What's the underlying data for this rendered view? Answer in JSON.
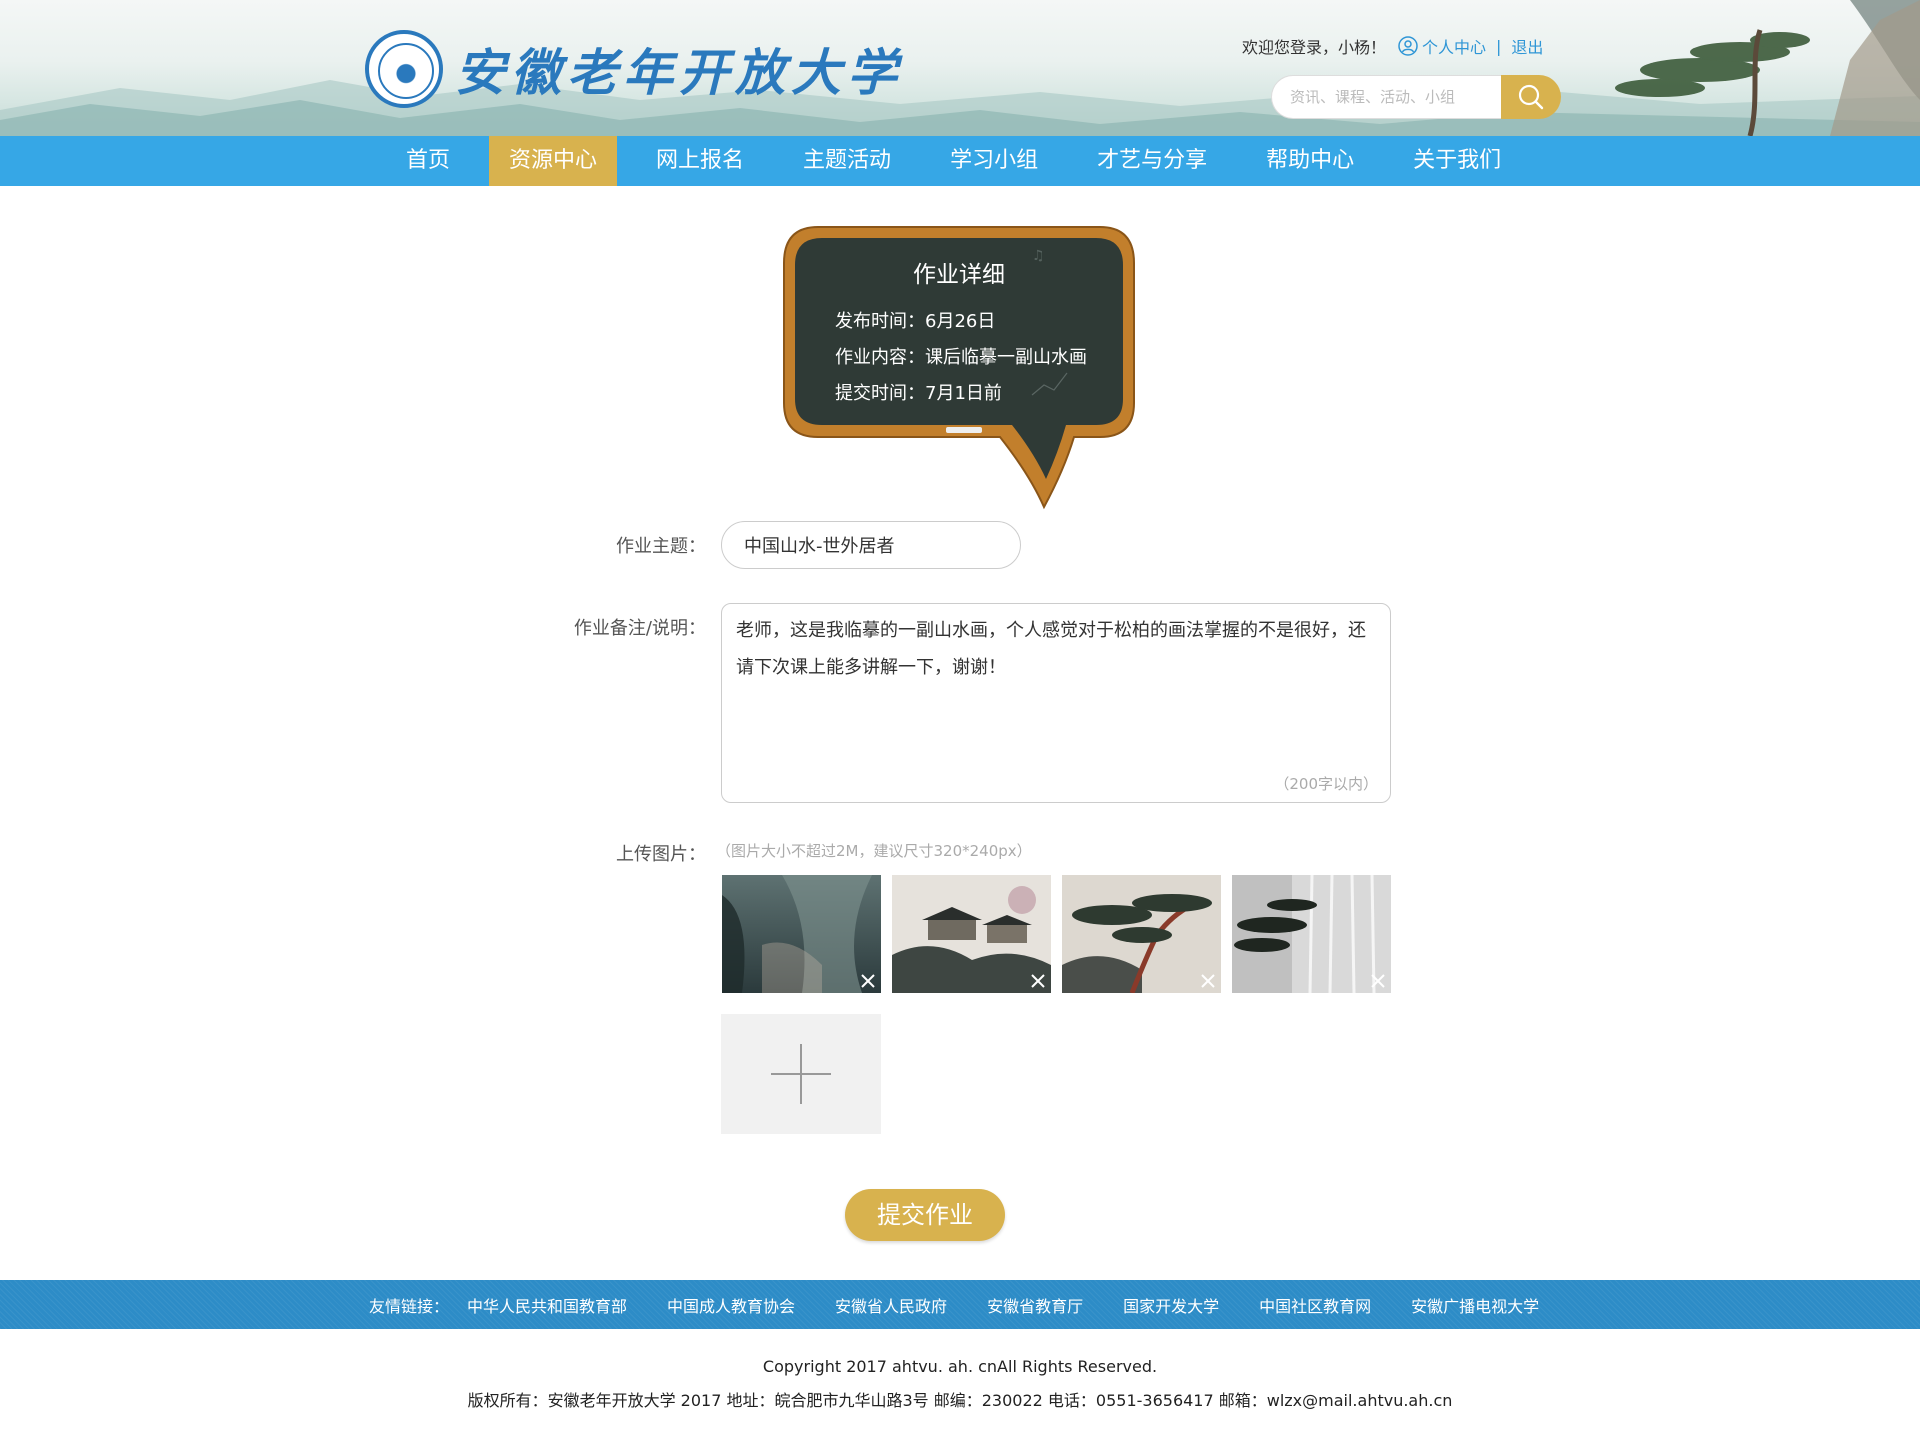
{
  "header": {
    "site_title": "安徽老年开放大学",
    "welcome": "欢迎您登录，小杨！",
    "user_center": "个人中心",
    "separator": "|",
    "logout": "退出",
    "search_placeholder": "资讯、课程、活动、小组",
    "search_icon": "search-icon",
    "logo_icon": "university-seal-icon"
  },
  "nav": {
    "items": [
      "首页",
      "资源中心",
      "网上报名",
      "主题活动",
      "学习小组",
      "才艺与分享",
      "帮助中心",
      "关于我们"
    ],
    "active": "资源中心"
  },
  "board": {
    "title": "作业详细",
    "publish": "发布时间：6月26日",
    "content": "作业内容：课后临摹一副山水画",
    "deadline": "提交时间：7月1日前"
  },
  "form": {
    "topic_label": "作业主题：",
    "topic_value": "中国山水-世外居者",
    "note_label": "作业备注/说明：",
    "note_value": "老师，这是我临摹的一副山水画，个人感觉对于松柏的画法掌握的不是很好，还请下次课上能多讲解一下，谢谢！",
    "note_limit": "（200字以内）",
    "upload_label": "上传图片：",
    "upload_hint": "（图片大小不超过2M，建议尺寸320*240px）",
    "thumbnails": [
      "landscape-painting-1",
      "landscape-painting-2",
      "landscape-painting-3",
      "landscape-painting-4"
    ],
    "remove_icon": "close-icon",
    "add_icon": "plus-icon",
    "submit": "提交作业"
  },
  "footer": {
    "links_label": "友情链接：",
    "links": [
      "中华人民共和国教育部",
      "中国成人教育协会",
      "安徽省人民政府",
      "安徽省教育厅",
      "国家开发大学",
      "中国社区教育网",
      "安徽广播电视大学"
    ],
    "copyright": "Copyright 2017 ahtvu. ah. cnAll Rights Reserved.",
    "info": "版权所有：安徽老年开放大学 2017 地址：皖合肥市九华山路3号 邮编：230022 电话：0551-3656417 邮箱：wlzx@mail.ahtvu.ah.cn"
  },
  "colors": {
    "nav_blue": "#36a7e6",
    "gold": "#d8b24e",
    "link_blue": "#2f96d6",
    "footer_blue": "#2d8cc7",
    "board_green": "#2f3a36",
    "board_frame": "#b8792a"
  }
}
